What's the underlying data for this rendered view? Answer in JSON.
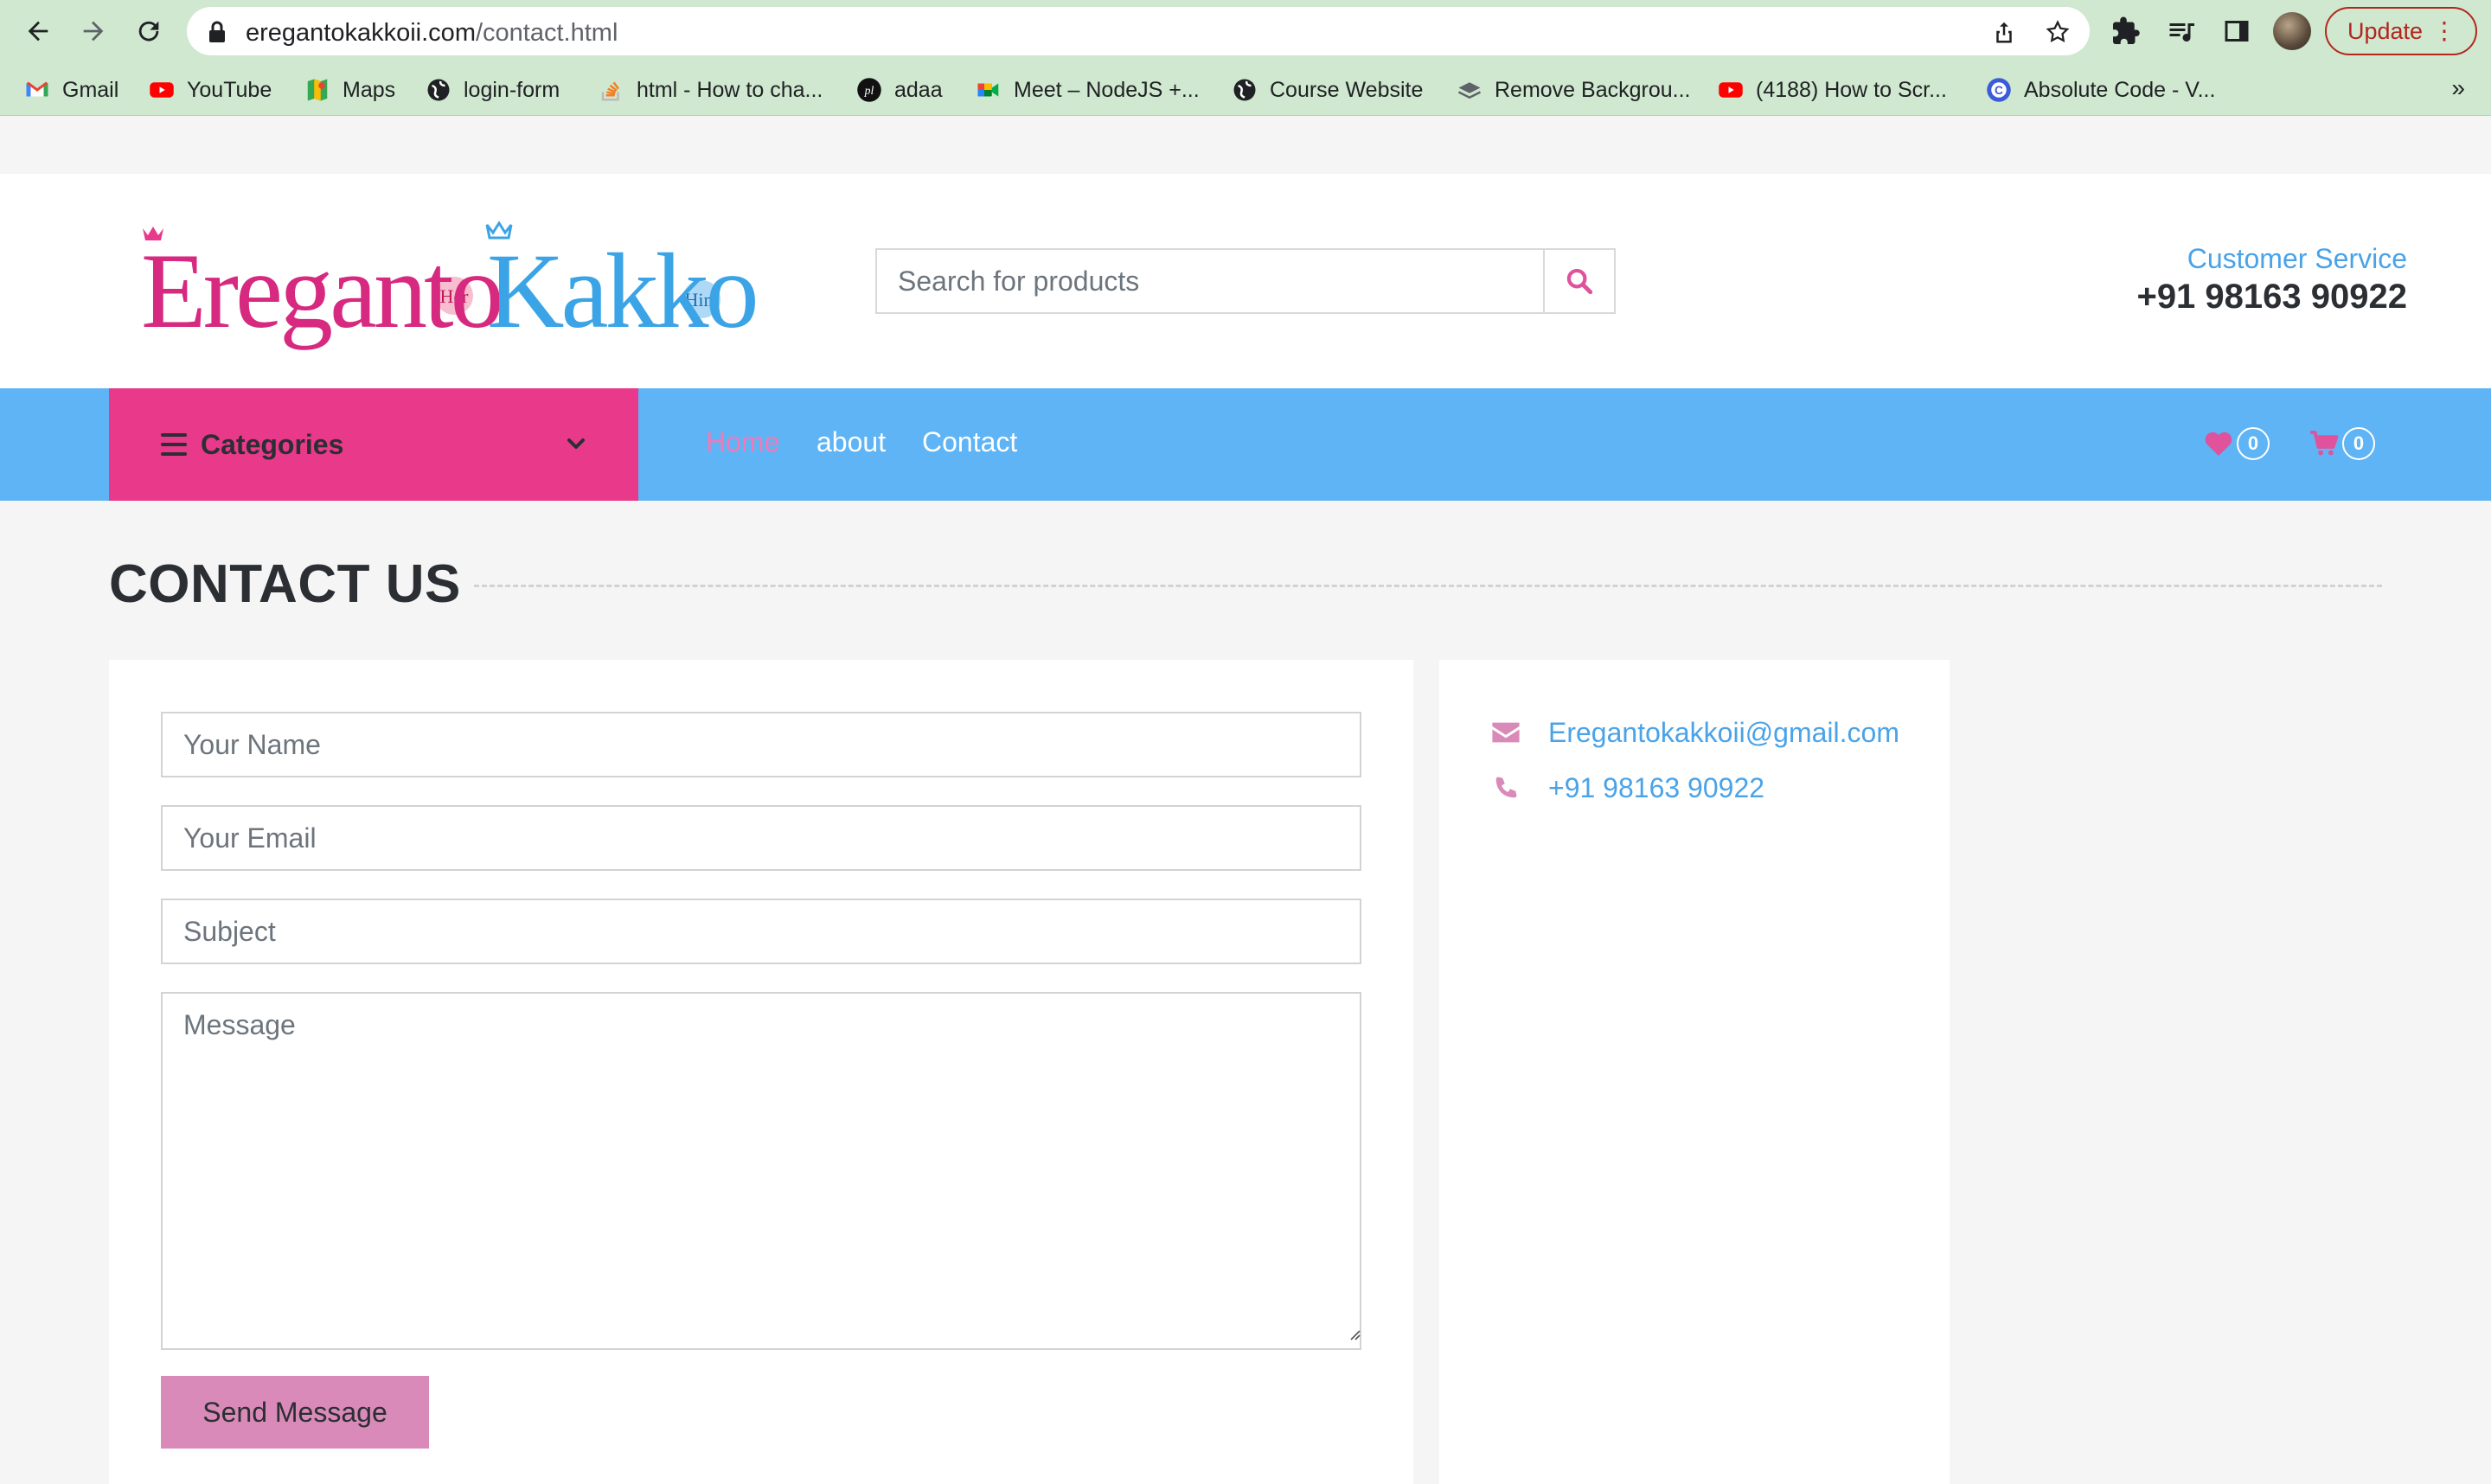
{
  "browser": {
    "url_domain": "eregantokakkoii.com",
    "url_path": "/contact.html",
    "update_label": "Update",
    "bookmarks": [
      {
        "label": "Gmail",
        "icon": "gmail-icon"
      },
      {
        "label": "YouTube",
        "icon": "youtube-icon"
      },
      {
        "label": "Maps",
        "icon": "maps-icon"
      },
      {
        "label": "login-form",
        "icon": "globe-icon"
      },
      {
        "label": "html - How to cha...",
        "icon": "stackoverflow-icon"
      },
      {
        "label": "adaa",
        "icon": "pl-icon"
      },
      {
        "label": "Meet – NodeJS +...",
        "icon": "meet-icon"
      },
      {
        "label": "Course Website",
        "icon": "globe-icon"
      },
      {
        "label": "Remove Backgrou...",
        "icon": "layers-icon"
      },
      {
        "label": "(4188) How to Scr...",
        "icon": "youtube-icon"
      },
      {
        "label": "Absolute Code - V...",
        "icon": "absolute-code-icon"
      }
    ],
    "bookmarks_more": "»"
  },
  "site": {
    "logo_text": "ErегantoKakkoii",
    "logo_left": "Eregant",
    "logo_o": "o",
    "logo_right": "Kakkoii",
    "logo_her": "Her",
    "logo_him": "Him",
    "search_placeholder": "Search for products",
    "customer_service_label": "Customer Service",
    "customer_service_phone": "+91 98163 90922"
  },
  "nav": {
    "categories_label": "Categories",
    "links": [
      "Home",
      "about",
      "Contact"
    ],
    "wishlist_count": "0",
    "cart_count": "0"
  },
  "contact": {
    "title": "CONTACT US",
    "name_placeholder": "Your Name",
    "email_placeholder": "Your Email",
    "subject_placeholder": "Subject",
    "message_placeholder": "Message",
    "send_label": "Send Message",
    "email": "Eregantokakkoii@gmail.com",
    "phone": "+91 98163 90922"
  },
  "colors": {
    "nav_blue": "#5fb4f5",
    "categories_pink": "#e8398a",
    "button_pink": "#d98ab8",
    "link_blue": "#4aa3e8",
    "chrome_green": "#cfe8cf"
  }
}
